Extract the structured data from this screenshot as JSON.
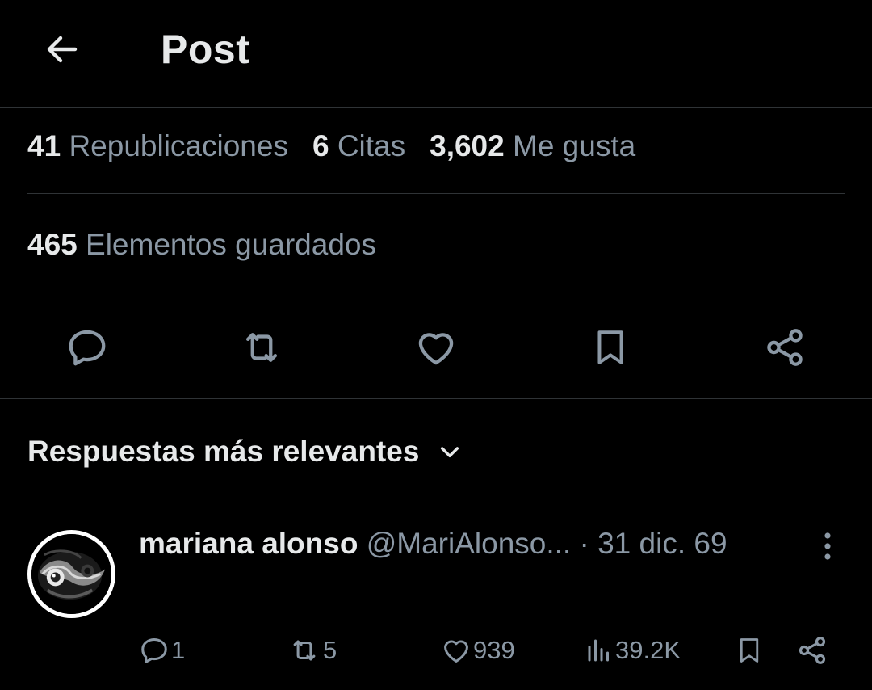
{
  "header": {
    "title": "Post",
    "back_icon": "arrow-left-icon"
  },
  "stats": {
    "reposts_count": "41",
    "reposts_label": "Republicaciones",
    "quotes_count": "6",
    "quotes_label": "Citas",
    "likes_count": "3,602",
    "likes_label": "Me gusta",
    "bookmarks_count": "465",
    "bookmarks_label": "Elementos guardados"
  },
  "actions": [
    "reply-icon",
    "repost-icon",
    "like-icon",
    "bookmark-icon",
    "share-icon"
  ],
  "replies": {
    "sort_label": "Respuestas más relevantes",
    "items": [
      {
        "name": "mariana alonso",
        "handle": "@MariAlonso...",
        "separator": "·",
        "date": "31 dic. 69",
        "reply_count": "1",
        "repost_count": "5",
        "like_count": "939",
        "view_count": "39.2K"
      }
    ]
  },
  "colors": {
    "background": "#000000",
    "text": "#e7e9ea",
    "muted": "#8b98a5",
    "divider": "#2f3336"
  }
}
